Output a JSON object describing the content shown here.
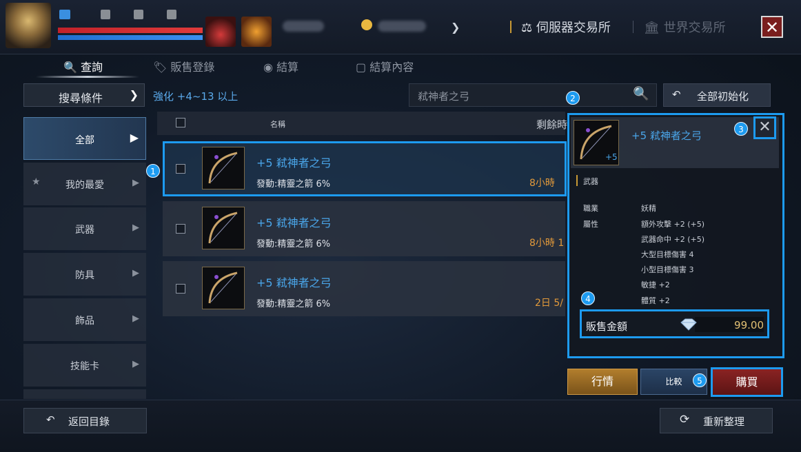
{
  "header": {
    "server_exchange": "伺服器交易所",
    "world_exchange": "世界交易所"
  },
  "tabs": [
    {
      "label": "查詢",
      "icon": "search-icon"
    },
    {
      "label": "販售登錄",
      "icon": "tag-icon"
    },
    {
      "label": "結算",
      "icon": "coins-icon"
    },
    {
      "label": "結算內容",
      "icon": "document-icon"
    }
  ],
  "filter": {
    "search_conditions": "搜尋條件",
    "enhance_range": "強化 +4~13 以上",
    "search_value": "弒神者之弓",
    "reset_all": "全部初始化"
  },
  "categories": [
    {
      "label": "全部",
      "active": true
    },
    {
      "label": "我的最愛",
      "icon": "star-icon"
    },
    {
      "label": "武器"
    },
    {
      "label": "防具"
    },
    {
      "label": "飾品"
    },
    {
      "label": "技能卡"
    }
  ],
  "list": {
    "col_name": "名稱",
    "col_remaining": "剩餘時",
    "rows": [
      {
        "name": "+5 弒神者之弓",
        "sub": "發動:精靈之箭 6%",
        "time": "8小時"
      },
      {
        "name": "+5 弒神者之弓",
        "sub": "發動:精靈之箭 6%",
        "time": "8小時 1"
      },
      {
        "name": "+5 弒神者之弓",
        "sub": "發動:精靈之箭 6%",
        "time": "2日 5/"
      }
    ]
  },
  "detail": {
    "name": "+5 弒神者之弓",
    "enh": "+5",
    "category": "武器",
    "job_label": "職業",
    "job_value": "妖精",
    "attr_label": "屬性",
    "attrs": [
      "額外攻擊 +2 (+5)",
      "武器命中 +2 (+5)",
      "大型目標傷害 4",
      "小型目標傷害 3",
      "敏捷 +2",
      "體質 +2"
    ],
    "price_label": "販售金額",
    "price_value": "99.00"
  },
  "actions": {
    "market": "行情",
    "compare": "比較",
    "buy": "購買"
  },
  "bottom": {
    "back": "返回目錄",
    "refresh": "重新整理"
  },
  "markers": [
    "1",
    "2",
    "3",
    "4",
    "5"
  ],
  "colors": {
    "highlight": "#1d9bf0",
    "item_name": "#4aa6ea",
    "time": "#e39a3a",
    "price": "#e2c074"
  }
}
